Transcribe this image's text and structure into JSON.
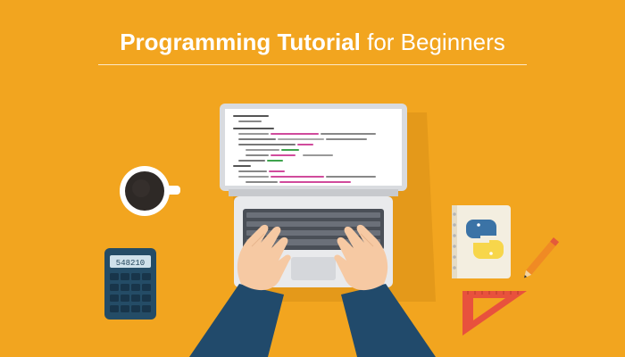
{
  "header": {
    "title_bold": "Programming Tutorial",
    "title_regular": "for Beginners"
  },
  "calculator": {
    "display": "548210"
  },
  "colors": {
    "background": "#f2a51f",
    "laptop_body": "#e9eaec",
    "screen": "#ffffff",
    "sleeve": "#214a6b",
    "skin": "#f6c9a3",
    "python_blue": "#3b73a6",
    "python_yellow": "#f7d64b",
    "ruler": "#e8513d"
  },
  "icons": [
    "laptop-icon",
    "coffee-cup-icon",
    "calculator-icon",
    "python-logo-icon",
    "pencil-icon",
    "set-square-icon"
  ]
}
